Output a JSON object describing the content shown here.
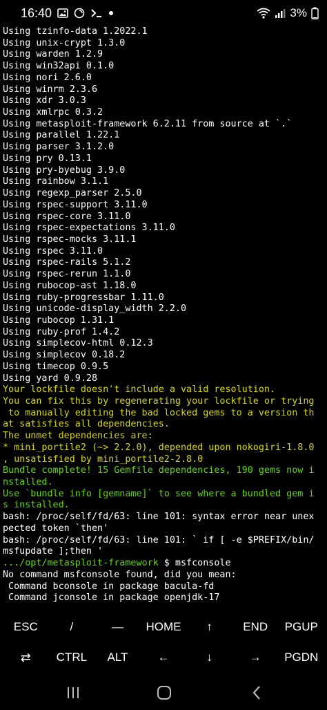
{
  "status_bar": {
    "time": "16:40",
    "battery": "3%",
    "left_icons": [
      "image-icon",
      "lock-circle-icon",
      "terminal-prompt-icon",
      "dot-icon"
    ],
    "right_icons": [
      "wifi-icon",
      "signal-icon",
      "battery-icon"
    ]
  },
  "terminal": {
    "lines": [
      {
        "text": "Using tzinfo-data 1.2022.1",
        "color": "default"
      },
      {
        "text": "Using unix-crypt 1.3.0",
        "color": "default"
      },
      {
        "text": "Using warden 1.2.9",
        "color": "default"
      },
      {
        "text": "Using win32api 0.1.0",
        "color": "default"
      },
      {
        "text": "Using nori 2.6.0",
        "color": "default"
      },
      {
        "text": "Using winrm 2.3.6",
        "color": "default"
      },
      {
        "text": "Using xdr 3.0.3",
        "color": "default"
      },
      {
        "text": "Using xmlrpc 0.3.2",
        "color": "default"
      },
      {
        "text": "Using metasploit-framework 6.2.11 from source at `.`",
        "color": "default"
      },
      {
        "text": "Using parallel 1.22.1",
        "color": "default"
      },
      {
        "text": "Using parser 3.1.2.0",
        "color": "default"
      },
      {
        "text": "Using pry 0.13.1",
        "color": "default"
      },
      {
        "text": "Using pry-byebug 3.9.0",
        "color": "default"
      },
      {
        "text": "Using rainbow 3.1.1",
        "color": "default"
      },
      {
        "text": "Using regexp_parser 2.5.0",
        "color": "default"
      },
      {
        "text": "Using rspec-support 3.11.0",
        "color": "default"
      },
      {
        "text": "Using rspec-core 3.11.0",
        "color": "default"
      },
      {
        "text": "Using rspec-expectations 3.11.0",
        "color": "default"
      },
      {
        "text": "Using rspec-mocks 3.11.1",
        "color": "default"
      },
      {
        "text": "Using rspec 3.11.0",
        "color": "default"
      },
      {
        "text": "Using rspec-rails 5.1.2",
        "color": "default"
      },
      {
        "text": "Using rspec-rerun 1.1.0",
        "color": "default"
      },
      {
        "text": "Using rubocop-ast 1.18.0",
        "color": "default"
      },
      {
        "text": "Using ruby-progressbar 1.11.0",
        "color": "default"
      },
      {
        "text": "Using unicode-display_width 2.2.0",
        "color": "default"
      },
      {
        "text": "Using rubocop 1.31.1",
        "color": "default"
      },
      {
        "text": "Using ruby-prof 1.4.2",
        "color": "default"
      },
      {
        "text": "Using simplecov-html 0.12.3",
        "color": "default"
      },
      {
        "text": "Using simplecov 0.18.2",
        "color": "default"
      },
      {
        "text": "Using timecop 0.9.5",
        "color": "default"
      },
      {
        "text": "Using yard 0.9.28",
        "color": "default"
      },
      {
        "text": "Your lockfile doesn't include a valid resolution.",
        "color": "yellow"
      },
      {
        "text": "You can fix this by regenerating your lockfile or trying",
        "color": "yellow"
      },
      {
        "text": " to manually editing the bad locked gems to a version th",
        "color": "yellow"
      },
      {
        "text": "at satisfies all dependencies.",
        "color": "yellow"
      },
      {
        "text": "The unmet dependencies are:",
        "color": "yellow"
      },
      {
        "text": "* mini_portile2 (~> 2.2.0), depended upon nokogiri-1.8.0",
        "color": "yellow"
      },
      {
        "text": ", unsatisfied by mini_portile2-2.8.0",
        "color": "yellow"
      },
      {
        "text": "Bundle complete! 15 Gemfile dependencies, 190 gems now i",
        "color": "green"
      },
      {
        "text": "nstalled.",
        "color": "green"
      },
      {
        "text": "Use `bundle info [gemname]` to see where a bundled gem i",
        "color": "green"
      },
      {
        "text": "s installed.",
        "color": "green"
      },
      {
        "text": "bash: /proc/self/fd/63: line 101: syntax error near unex",
        "color": "default"
      },
      {
        "text": "pected token `then'",
        "color": "default"
      },
      {
        "text": "bash: /proc/self/fd/63: line 101: ` if [ -e $PREFIX/bin/",
        "color": "default"
      },
      {
        "text": "msfupdate ];then '",
        "color": "default"
      },
      {
        "prompt": ".../opt/metasploit-framework",
        "command": " $ msfconsole"
      },
      {
        "text": "No command msfconsole found, did you mean:",
        "color": "default"
      },
      {
        "text": " Command bconsole in package bacula-fd",
        "color": "default"
      },
      {
        "text": " Command jconsole in package openjdk-17",
        "color": "default"
      }
    ]
  },
  "extra_keys": {
    "row1": [
      {
        "label": "ESC",
        "name": "esc-key"
      },
      {
        "label": "/",
        "name": "slash-key"
      },
      {
        "label": "—",
        "name": "dash-key"
      },
      {
        "label": "HOME",
        "name": "home-key"
      },
      {
        "label": "↑",
        "name": "arrow-up-key"
      },
      {
        "label": "END",
        "name": "end-key"
      },
      {
        "label": "PGUP",
        "name": "pgup-key"
      }
    ],
    "row2": [
      {
        "label": "⇄",
        "name": "tab-key",
        "icon": "tab-arrows-icon"
      },
      {
        "label": "CTRL",
        "name": "ctrl-key"
      },
      {
        "label": "ALT",
        "name": "alt-key"
      },
      {
        "label": "←",
        "name": "arrow-left-key"
      },
      {
        "label": "↓",
        "name": "arrow-down-key"
      },
      {
        "label": "→",
        "name": "arrow-right-key"
      },
      {
        "label": "PGDN",
        "name": "pgdn-key"
      }
    ]
  },
  "nav_bar": {
    "buttons": [
      "recents-icon",
      "home-icon",
      "back-icon"
    ]
  },
  "colors": {
    "background": "#000000",
    "text_default": "#ffffff",
    "text_yellow": "#d7d700",
    "text_green": "#5fd700"
  }
}
